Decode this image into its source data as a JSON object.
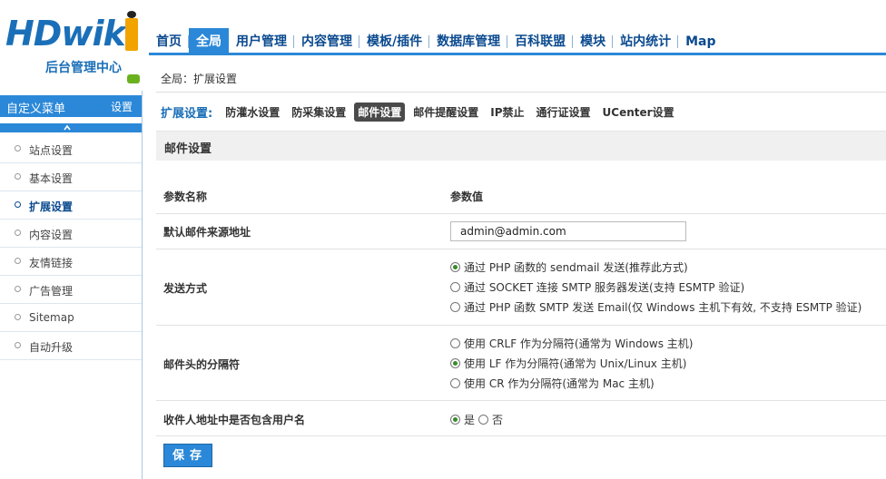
{
  "brand": {
    "logo_text": "HDwiki",
    "subtitle": "后台管理中心"
  },
  "topnav": {
    "items": [
      {
        "label": "首页",
        "active": false
      },
      {
        "label": "全局",
        "active": true
      },
      {
        "label": "用户管理",
        "active": false
      },
      {
        "label": "内容管理",
        "active": false
      },
      {
        "label": "模板/插件",
        "active": false
      },
      {
        "label": "数据库管理",
        "active": false
      },
      {
        "label": "百科联盟",
        "active": false
      },
      {
        "label": "模块",
        "active": false
      },
      {
        "label": "站内统计",
        "active": false
      },
      {
        "label": "Map",
        "active": false
      }
    ]
  },
  "sidebar": {
    "title": "自定义菜单",
    "settings_label": "设置",
    "items": [
      {
        "label": "站点设置"
      },
      {
        "label": "基本设置"
      },
      {
        "label": "扩展设置",
        "active": true
      },
      {
        "label": "内容设置"
      },
      {
        "label": "友情链接"
      },
      {
        "label": "广告管理"
      },
      {
        "label": "Sitemap"
      },
      {
        "label": "自动升级"
      }
    ]
  },
  "main": {
    "breadcrumb": "全局：扩展设置",
    "tabs_lead": "扩展设置:",
    "tabs": [
      {
        "label": "防灌水设置"
      },
      {
        "label": "防采集设置"
      },
      {
        "label": "邮件设置",
        "active": true
      },
      {
        "label": "邮件提醒设置"
      },
      {
        "label": "IP禁止"
      },
      {
        "label": "通行证设置"
      },
      {
        "label": "UCenter设置"
      }
    ],
    "section_title": "邮件设置",
    "header": {
      "name": "参数名称",
      "value": "参数值"
    },
    "from_label": "默认邮件来源地址",
    "from_value": "admin@admin.com",
    "send_label": "发送方式",
    "send_options": [
      {
        "label": "通过 PHP 函数的 sendmail 发送(推荐此方式)",
        "checked": true
      },
      {
        "label": "通过 SOCKET 连接 SMTP 服务器发送(支持 ESMTP 验证)",
        "checked": false
      },
      {
        "label": "通过 PHP 函数 SMTP 发送 Email(仅 Windows 主机下有效, 不支持 ESMTP 验证)",
        "checked": false
      }
    ],
    "sep_label": "邮件头的分隔符",
    "sep_options": [
      {
        "label": "使用 CRLF 作为分隔符(通常为 Windows 主机)",
        "checked": false
      },
      {
        "label": "使用 LF 作为分隔符(通常为 Unix/Linux 主机)",
        "checked": true
      },
      {
        "label": "使用 CR 作为分隔符(通常为 Mac 主机)",
        "checked": false
      }
    ],
    "username_label": "收件人地址中是否包含用户名",
    "username_yes": "是",
    "username_no": "否",
    "save_label": "保存"
  }
}
